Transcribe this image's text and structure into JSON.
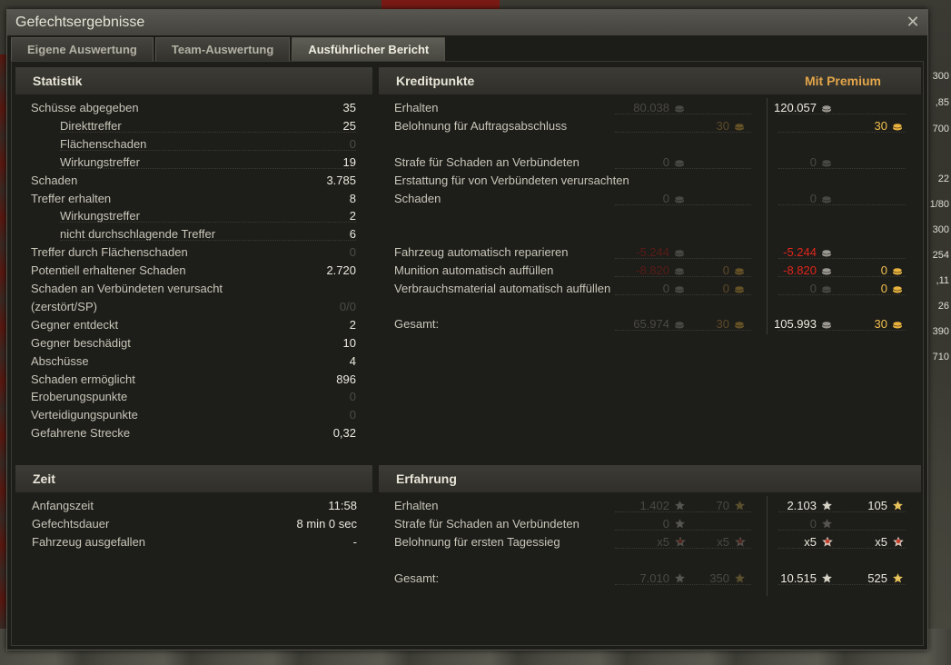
{
  "window": {
    "title": "Gefechtsergebnisse",
    "tabs": [
      {
        "label": "Eigene Auswertung",
        "active": false
      },
      {
        "label": "Team-Auswertung",
        "active": false
      },
      {
        "label": "Ausführlicher Bericht",
        "active": true
      }
    ]
  },
  "background_numbers": [
    "300",
    ",85",
    "700",
    "22",
    "1/80",
    "300",
    "254",
    ",11",
    "26",
    "390",
    "710"
  ],
  "statistik": {
    "title": "Statistik",
    "rows": [
      {
        "label": "Schüsse abgegeben",
        "value": "35",
        "indent": false,
        "dim": false
      },
      {
        "label": "Direkttreffer",
        "value": "25",
        "indent": true,
        "dim": false
      },
      {
        "label": "Flächenschaden",
        "value": "0",
        "indent": true,
        "dim": true
      },
      {
        "label": "Wirkungstreffer",
        "value": "19",
        "indent": true,
        "dim": false
      },
      {
        "label": "Schaden",
        "value": "3.785",
        "indent": false,
        "dim": false
      },
      {
        "label": "Treffer erhalten",
        "value": "8",
        "indent": false,
        "dim": false
      },
      {
        "label": "Wirkungstreffer",
        "value": "2",
        "indent": true,
        "dim": false
      },
      {
        "label": "nicht durchschlagende Treffer",
        "value": "6",
        "indent": true,
        "dim": false
      },
      {
        "label": "Treffer durch Flächenschaden",
        "value": "0",
        "indent": false,
        "dim": true
      },
      {
        "label": "Potentiell erhaltener Schaden",
        "value": "2.720",
        "indent": false,
        "dim": false
      },
      {
        "label": "Schaden an Verbündeten verursacht",
        "value": "",
        "indent": false,
        "dim": false
      },
      {
        "label": "(zerstört/SP)",
        "value": "0/0",
        "indent": false,
        "dim": true
      },
      {
        "label": "Gegner entdeckt",
        "value": "2",
        "indent": false,
        "dim": false
      },
      {
        "label": "Gegner beschädigt",
        "value": "10",
        "indent": false,
        "dim": false
      },
      {
        "label": "Abschüsse",
        "value": "4",
        "indent": false,
        "dim": false
      },
      {
        "label": "Schaden ermöglicht",
        "value": "896",
        "indent": false,
        "dim": false
      },
      {
        "label": "Eroberungspunkte",
        "value": "0",
        "indent": false,
        "dim": true
      },
      {
        "label": "Verteidigungspunkte",
        "value": "0",
        "indent": false,
        "dim": true
      },
      {
        "label": "Gefahrene Strecke",
        "value": "0,32",
        "indent": false,
        "dim": false
      }
    ]
  },
  "kredit": {
    "title": "Kreditpunkte",
    "premium_label": "Mit Premium",
    "rows": [
      {
        "label": "Erhalten",
        "std_credits": "80.038",
        "std_gold": "",
        "prem_credits": "120.057",
        "prem_gold": ""
      },
      {
        "label": "Belohnung für Auftragsabschluss",
        "std_credits": "",
        "std_gold": "30",
        "prem_credits": "",
        "prem_gold": "30"
      },
      {
        "label": "Strafe für Schaden an Verbündeten",
        "std_credits": "0",
        "std_gold": "",
        "prem_credits": "0",
        "prem_gold": ""
      },
      {
        "label": "Erstattung für von Verbündeten verursachten",
        "std_credits": "",
        "std_gold": "",
        "prem_credits": "",
        "prem_gold": ""
      },
      {
        "label": "Schaden",
        "std_credits": "0",
        "std_gold": "",
        "prem_credits": "0",
        "prem_gold": ""
      },
      {
        "label": "Fahrzeug automatisch reparieren",
        "std_credits": "-5.244",
        "std_gold": "",
        "prem_credits": "-5.244",
        "prem_gold": ""
      },
      {
        "label": "Munition automatisch auffüllen",
        "std_credits": "-8.820",
        "std_gold": "0",
        "prem_credits": "-8.820",
        "prem_gold": "0"
      },
      {
        "label": "Verbrauchsmaterial automatisch auffüllen",
        "std_credits": "0",
        "std_gold": "0",
        "prem_credits": "0",
        "prem_gold": "0"
      },
      {
        "label": "Gesamt:",
        "std_credits": "65.974",
        "std_gold": "30",
        "prem_credits": "105.993",
        "prem_gold": "30"
      }
    ]
  },
  "zeit": {
    "title": "Zeit",
    "rows": [
      {
        "label": "Anfangszeit",
        "value": "11:58"
      },
      {
        "label": "Gefechtsdauer",
        "value": "8 min 0 sec"
      },
      {
        "label": "Fahrzeug ausgefallen",
        "value": "-"
      }
    ]
  },
  "erfahrung": {
    "title": "Erfahrung",
    "rows": [
      {
        "label": "Erhalten",
        "std_xp": "1.402",
        "std_free": "70",
        "prem_xp": "2.103",
        "prem_free": "105"
      },
      {
        "label": "Strafe für Schaden an Verbündeten",
        "std_xp": "0",
        "std_free": "",
        "prem_xp": "0",
        "prem_free": ""
      },
      {
        "label": "Belohnung für ersten Tagessieg",
        "std_xp": "x5",
        "std_free": "x5",
        "prem_xp": "x5",
        "prem_free": "x5"
      },
      {
        "label": "Gesamt:",
        "std_xp": "7.010",
        "std_free": "350",
        "prem_xp": "10.515",
        "prem_free": "525"
      }
    ]
  },
  "colors": {
    "premium_orange": "#e2a54a",
    "gold": "#f2c04e",
    "negative_red": "#e0261a",
    "text_white": "#eceade",
    "text_dim": "#4a4943"
  }
}
